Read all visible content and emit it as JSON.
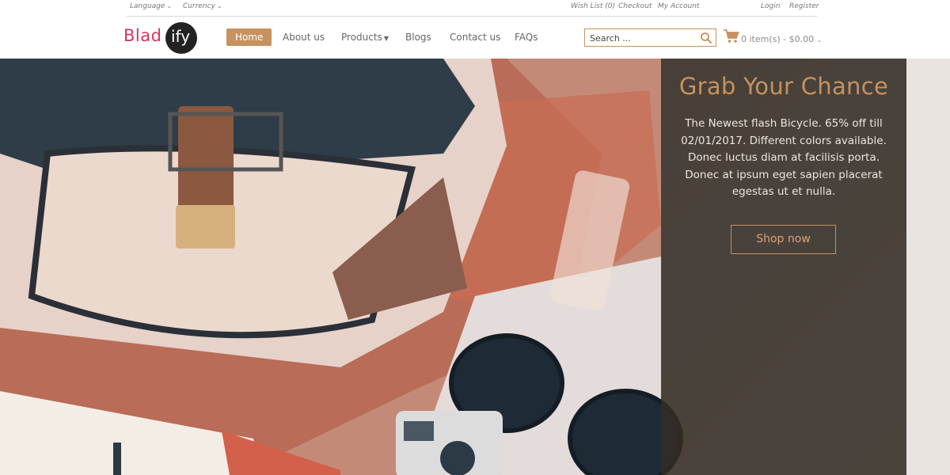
{
  "topbar": {
    "language": "Language",
    "currency": "Currency",
    "wishlist": "Wish List (0)",
    "checkout": "Checkout",
    "account": "My Account",
    "login": "Login",
    "register": "Register"
  },
  "header": {
    "logo_left": "Blad",
    "logo_right": "ify",
    "nav": {
      "home": "Home",
      "about": "About us",
      "products": "Products",
      "blogs": "Blogs",
      "contact": "Contact us",
      "faqs": "FAQs"
    },
    "search_placeholder": "Search ...",
    "cart": "0 item(s) - $0.00"
  },
  "hero": {
    "title": "Grab Your Chance",
    "description": "The Newest flash Bicycle. 65% off till 02/01/2017. Different colors available. Donec luctus diam at facilisis porta. Donec at ipsum eget sapien placerat egestas ut et nulla.",
    "button": "Shop now"
  },
  "colors": {
    "accent": "#c6925f",
    "logo_pink": "#d8345f",
    "overlay": "#342c26"
  },
  "icons": [
    "chevron-down-icon",
    "search-icon",
    "cart-icon"
  ]
}
